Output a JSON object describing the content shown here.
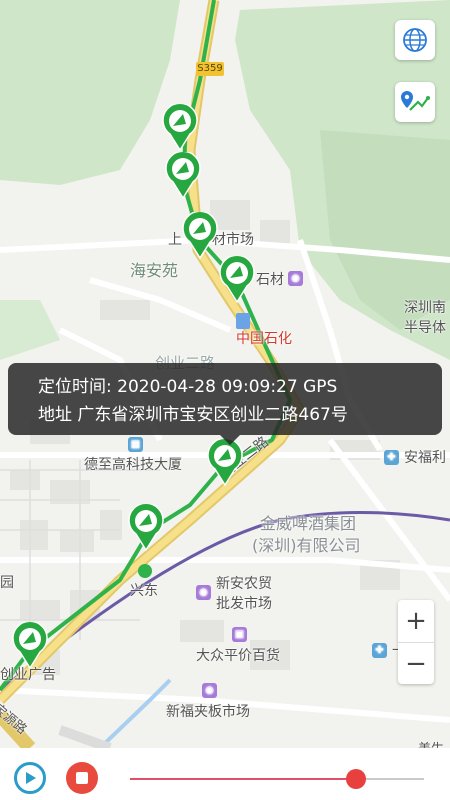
{
  "info": {
    "time_label": "定位时间:",
    "time_value": "2020-04-28 09:09:27",
    "source": "GPS",
    "addr_label": "地址",
    "addr_value": "广东省深圳市宝安区创业二路467号"
  },
  "map": {
    "road_badge": "S359",
    "labels": {
      "haiyanyuan": "海安苑",
      "shangcai": "上",
      "cai_market": "材市场",
      "shicai": "石材",
      "sinopec": "中国石化",
      "chuangye_faded": "创业二路",
      "shenzhen_semi": "深圳南",
      "semi2": "半导体",
      "dezhigao": "德至高科技大厦",
      "anfuli": "安福利",
      "chuangye2": "创业二路",
      "jinwei1": "金威啤酒集团",
      "jinwei2": "(深圳)有限公司",
      "xingdong": "兴东",
      "xinan1": "新安农贸",
      "xinan2": "批发市场",
      "yuan": "园",
      "dazhong": "大众平价百货",
      "chuangye_ad": "创业广告",
      "xinfu": "新福夹板市场",
      "yi": "一",
      "meisheng": "美生",
      "road_bl": "宝源路"
    }
  },
  "controls": {
    "globe_icon": "globe-icon",
    "route_icon": "route-icon",
    "zoom_in": "+",
    "zoom_out": "−"
  },
  "player": {
    "progress": 0.77
  },
  "colors": {
    "track": "#2fb24a",
    "pin_green": "#27a73f",
    "playback_blue": "#2a9cc8",
    "stop_red": "#e84b3d",
    "slider_fill": "#e0506a"
  }
}
